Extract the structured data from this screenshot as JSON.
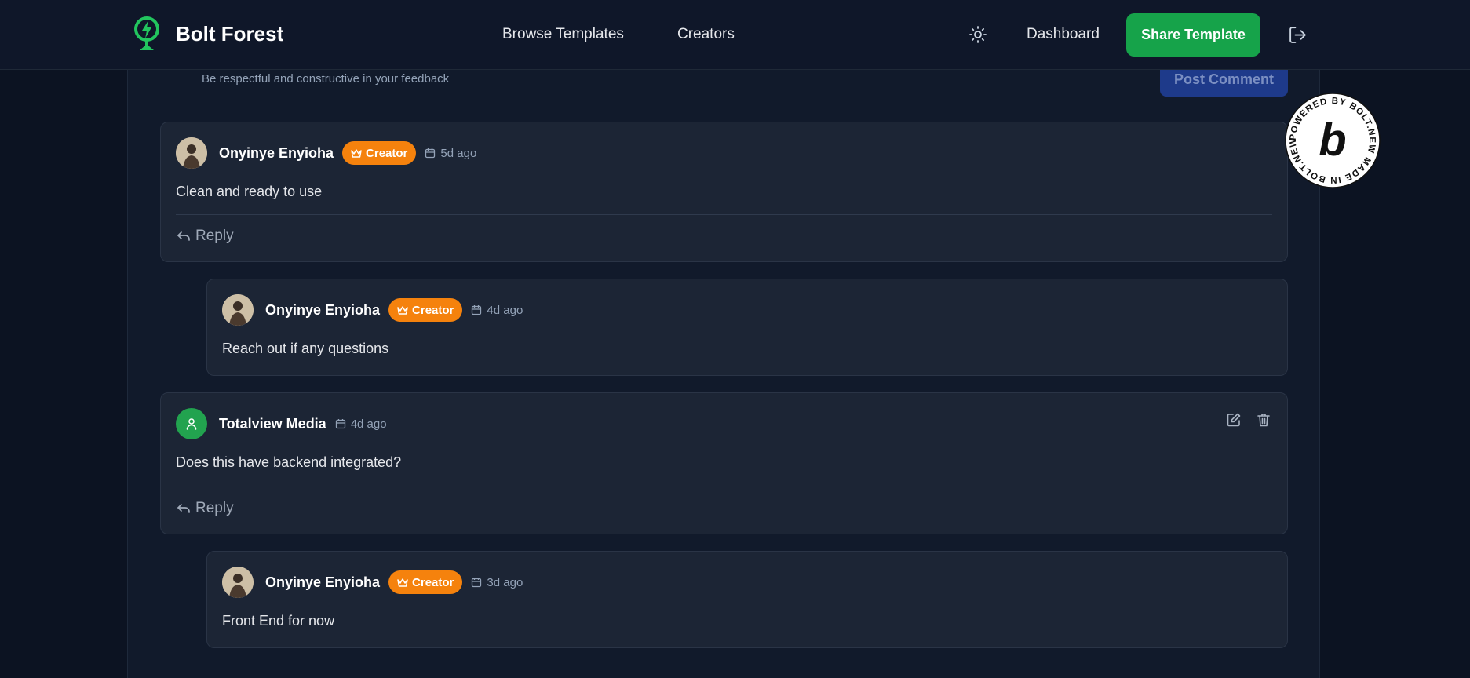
{
  "header": {
    "brand": "Bolt Forest",
    "nav": {
      "browse": "Browse Templates",
      "creators": "Creators",
      "dashboard": "Dashboard"
    },
    "share_button": "Share Template",
    "theme_icon": "sun-icon",
    "logout_icon": "logout-icon"
  },
  "comment_form": {
    "hint": "Be respectful and constructive in your feedback",
    "post_button": "Post Comment"
  },
  "comments": [
    {
      "author": "Onyinye Enyioha",
      "badge": "Creator",
      "date": "5d ago",
      "text": "Clean and ready to use",
      "reply_label": "Reply"
    },
    {
      "author": "Onyinye Enyioha",
      "badge": "Creator",
      "date": "4d ago",
      "text": "Reach out if any questions"
    },
    {
      "author": "Totalview Media",
      "date": "4d ago",
      "text": "Does this have backend integrated?",
      "reply_label": "Reply"
    },
    {
      "author": "Onyinye Enyioha",
      "badge": "Creator",
      "date": "3d ago",
      "text": "Front End for now"
    }
  ],
  "powered_badge": {
    "text": "POWERED BY BOLT.NEW MADE IN BOLT.NEW",
    "letter": "b"
  },
  "colors": {
    "background": "#0c1322",
    "card": "#1c2535",
    "accent_green": "#16a34a",
    "creator_badge": "#f5820d",
    "post_button": "#1e3a8a"
  }
}
